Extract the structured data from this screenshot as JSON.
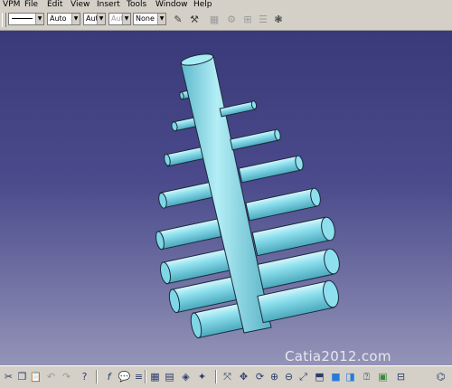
{
  "menu": {
    "items": [
      "VPM",
      "File",
      "Edit",
      "View",
      "Insert",
      "Tools",
      "Window",
      "Help"
    ]
  },
  "toolbar": {
    "line_type_value": "",
    "thickness_value": "Auto",
    "dash_value": "Aut",
    "layer_value": "Aut",
    "color_value": "None"
  },
  "viewport": {
    "watermark": "Catia2012.com",
    "part_color": "#7fd6e6",
    "background_top": "#3a3a7a",
    "background_bottom": "#9494b8"
  },
  "icons": {
    "toolbar": [
      "paint-brush-icon",
      "properties-icon",
      "sketch-icon",
      "constraint-icon",
      "axis-icon",
      "hand-icon"
    ],
    "bottom": [
      "cut-icon",
      "copy-icon",
      "paste-icon",
      "undo-icon",
      "redo-icon",
      "whats-this-icon",
      "formula-icon",
      "comment-icon",
      "knowledge-icon",
      "table-icon",
      "catalog-icon",
      "grid-icon",
      "fly-mode-icon",
      "fit-all-icon",
      "pan-icon",
      "rotate-icon",
      "zoom-in-icon",
      "zoom-out-icon",
      "normal-view-icon",
      "iso-view-icon",
      "shading-icon",
      "hide-show-icon",
      "swap-icon",
      "material-icon",
      "apply-icon",
      "measure-icon"
    ]
  }
}
